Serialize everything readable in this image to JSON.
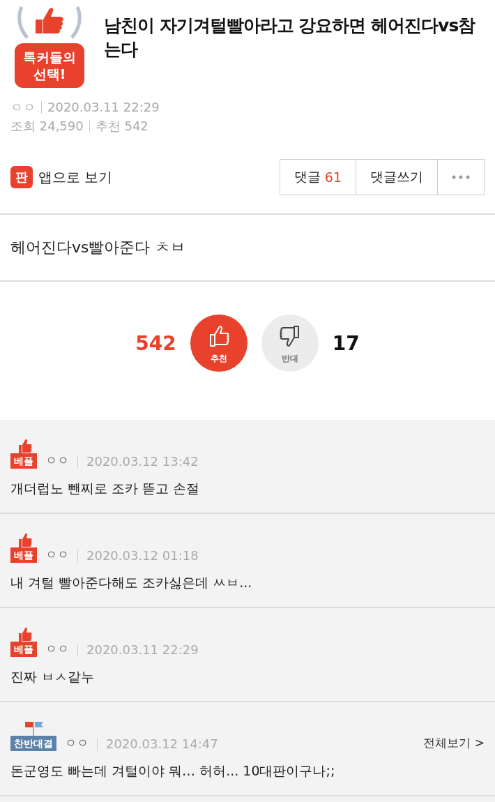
{
  "post": {
    "badge_lines": [
      "톡커들의",
      "선택!"
    ],
    "title": "남친이 자기겨털빨아라고 강요하면 헤어진다vs참는다",
    "author": "ㅇㅇ",
    "date": "2020.03.11 22:29",
    "views_label": "조회",
    "views": "24,590",
    "recommend_label": "추천",
    "recommend": "542"
  },
  "actions": {
    "app_link": "앱으로 보기",
    "app_icon_text": "판",
    "comments_label": "댓글",
    "comments_count": "61",
    "write_comment": "댓글쓰기"
  },
  "body": "헤어진다vs빨아준다 ㅊㅂ",
  "vote": {
    "up_count": "542",
    "up_label": "추천",
    "down_label": "반대",
    "down_count": "17"
  },
  "comments": [
    {
      "kind": "best",
      "badge": "베플",
      "author": "ㅇㅇ",
      "date": "2020.03.12 13:42",
      "text": "개더럽노 뺀찌로 조카 뜯고 손절"
    },
    {
      "kind": "best",
      "badge": "베플",
      "author": "ㅇㅇ",
      "date": "2020.03.12 01:18",
      "text": "내 겨털 빨아준다해도 조카싫은데 ㅆㅂ..."
    },
    {
      "kind": "best",
      "badge": "베플",
      "author": "ㅇㅇ",
      "date": "2020.03.11 22:29",
      "text": "진짜 ㅂㅅ같누"
    },
    {
      "kind": "debate",
      "badge": "찬반대결",
      "author": "ㅇㅇ",
      "date": "2020.03.12 14:47",
      "text": "돈군영도 빠는데 겨털이야 뭐… 허허... 10대판이구나;;",
      "link": "전체보기 >"
    }
  ]
}
